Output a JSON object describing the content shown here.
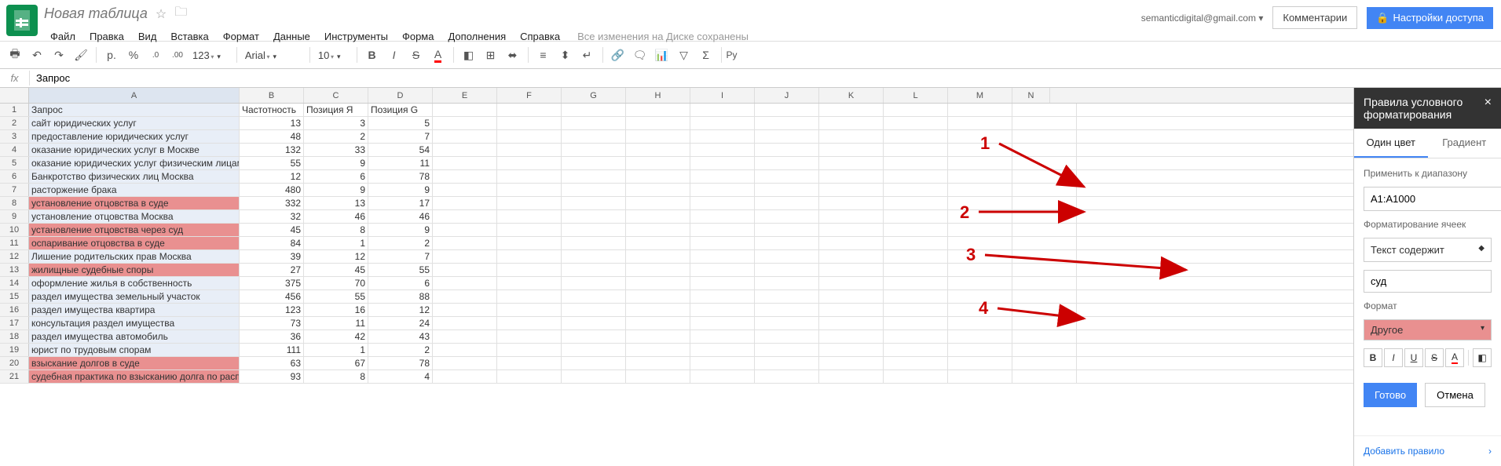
{
  "doc_title": "Новая таблица",
  "user_email": "semanticdigital@gmail.com",
  "buttons": {
    "comments": "Комментарии",
    "share": "Настройки доступа"
  },
  "menu": [
    "Файл",
    "Правка",
    "Вид",
    "Вставка",
    "Формат",
    "Данные",
    "Инструменты",
    "Форма",
    "Дополнения",
    "Справка"
  ],
  "save_status": "Все изменения на Диске сохранены",
  "toolbar": {
    "currency": "р.",
    "percent": "%",
    "dec_dec": ".0",
    "inc_dec": ".00",
    "more_formats": "123",
    "font": "Arial",
    "size": "10",
    "lang": "Ру"
  },
  "formula": "Запрос",
  "columns": [
    "A",
    "B",
    "C",
    "D",
    "E",
    "F",
    "G",
    "H",
    "I",
    "J",
    "K",
    "L",
    "M",
    "N"
  ],
  "headers": [
    "Запрос",
    "Частотность",
    "Позиция Я",
    "Позиция G"
  ],
  "rows": [
    {
      "n": 1,
      "a": "Запрос",
      "b": "Частотность",
      "c": "Позиция Я",
      "d": "Позиция G",
      "hl": false,
      "header": true
    },
    {
      "n": 2,
      "a": "сайт юридических услуг",
      "b": 13,
      "c": 3,
      "d": 5,
      "hl": false
    },
    {
      "n": 3,
      "a": "предоставление юридических услуг",
      "b": 48,
      "c": 2,
      "d": 7,
      "hl": false
    },
    {
      "n": 4,
      "a": "оказание юридических услуг в Москве",
      "b": 132,
      "c": 33,
      "d": 54,
      "hl": false
    },
    {
      "n": 5,
      "a": "оказание юридических услуг физическим лицам",
      "b": 55,
      "c": 9,
      "d": 11,
      "hl": false
    },
    {
      "n": 6,
      "a": "Банкротство физических лиц Москва",
      "b": 12,
      "c": 6,
      "d": 78,
      "hl": false
    },
    {
      "n": 7,
      "a": "расторжение брака",
      "b": 480,
      "c": 9,
      "d": 9,
      "hl": false
    },
    {
      "n": 8,
      "a": "установление отцовства в суде",
      "b": 332,
      "c": 13,
      "d": 17,
      "hl": true
    },
    {
      "n": 9,
      "a": "установление отцовства Москва",
      "b": 32,
      "c": 46,
      "d": 46,
      "hl": false
    },
    {
      "n": 10,
      "a": "установление отцовства через суд",
      "b": 45,
      "c": 8,
      "d": 9,
      "hl": true
    },
    {
      "n": 11,
      "a": "оспаривание отцовства в суде",
      "b": 84,
      "c": 1,
      "d": 2,
      "hl": true
    },
    {
      "n": 12,
      "a": "Лишение родительских прав Москва",
      "b": 39,
      "c": 12,
      "d": 7,
      "hl": false
    },
    {
      "n": 13,
      "a": "жилищные судебные споры",
      "b": 27,
      "c": 45,
      "d": 55,
      "hl": true
    },
    {
      "n": 14,
      "a": "оформление жилья в собственность",
      "b": 375,
      "c": 70,
      "d": 6,
      "hl": false
    },
    {
      "n": 15,
      "a": "раздел имущества земельный участок",
      "b": 456,
      "c": 55,
      "d": 88,
      "hl": false
    },
    {
      "n": 16,
      "a": "раздел имущества квартира",
      "b": 123,
      "c": 16,
      "d": 12,
      "hl": false
    },
    {
      "n": 17,
      "a": "консультация раздел имущества",
      "b": 73,
      "c": 11,
      "d": 24,
      "hl": false
    },
    {
      "n": 18,
      "a": "раздел имущества автомобиль",
      "b": 36,
      "c": 42,
      "d": 43,
      "hl": false
    },
    {
      "n": 19,
      "a": "юрист по трудовым спорам",
      "b": 111,
      "c": 1,
      "d": 2,
      "hl": false
    },
    {
      "n": 20,
      "a": "взыскание долгов в суде",
      "b": 63,
      "c": 67,
      "d": 78,
      "hl": true
    },
    {
      "n": 21,
      "a": "судебная практика по взысканию долга по расписке",
      "b": 93,
      "c": 8,
      "d": 4,
      "hl": true
    }
  ],
  "panel": {
    "title": "Правила условного форматирования",
    "tabs": {
      "single": "Один цвет",
      "gradient": "Градиент"
    },
    "apply_to": "Применить к диапазону",
    "range": "A1:A1000",
    "format_cells": "Форматирование ячеек",
    "condition": "Текст содержит",
    "value": "суд",
    "format_label": "Формат",
    "style": "Другое",
    "done": "Готово",
    "cancel": "Отмена",
    "add_rule": "Добавить правило"
  },
  "annotations": [
    "1",
    "2",
    "3",
    "4"
  ]
}
